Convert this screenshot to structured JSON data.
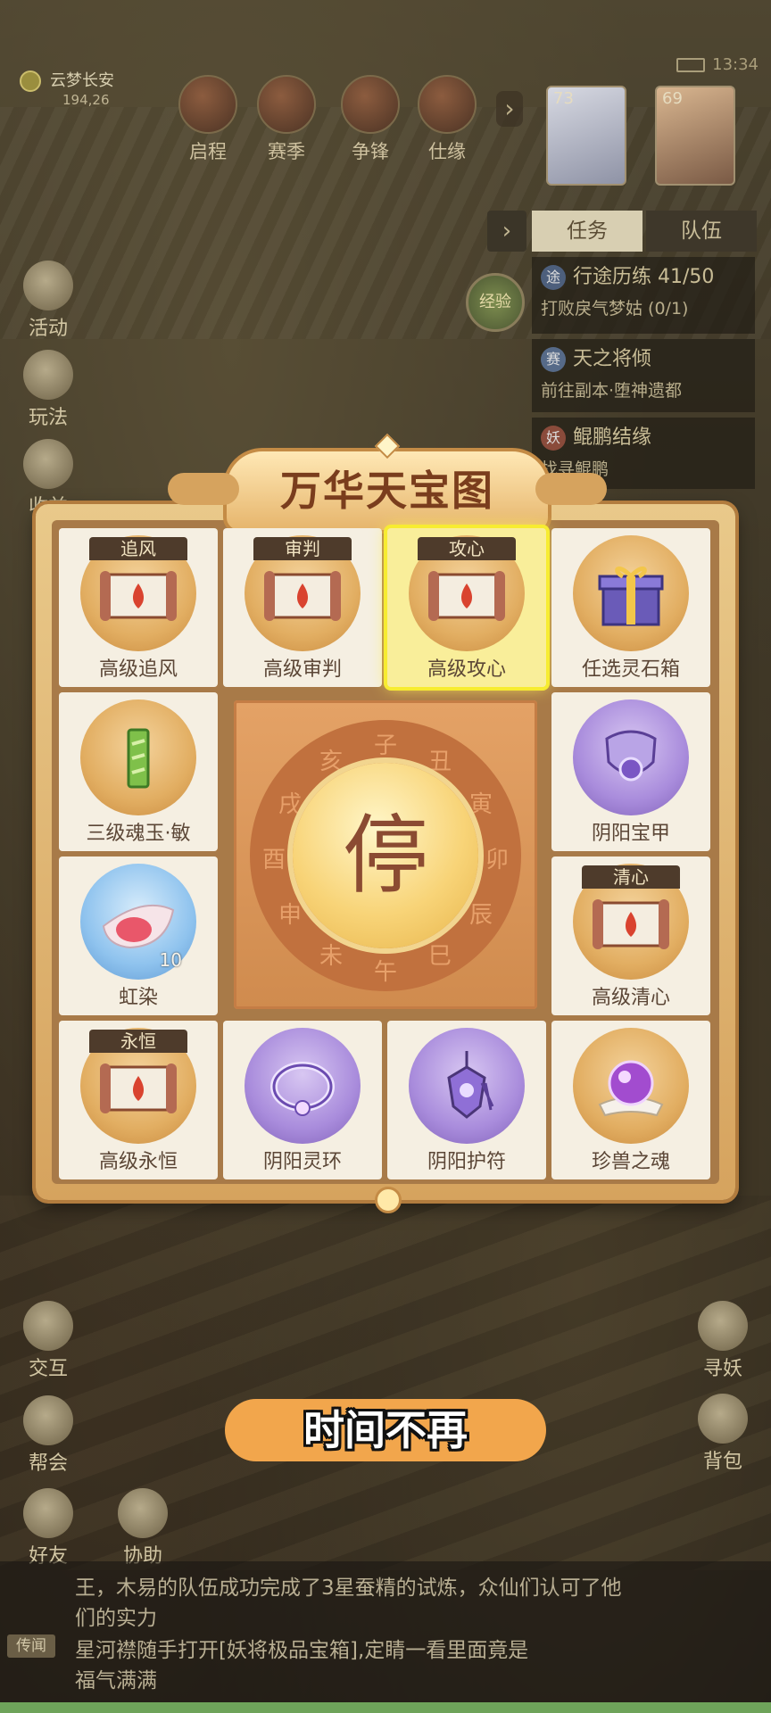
{
  "hud": {
    "location": "云梦长安",
    "coords": "194,26",
    "time": "13:34",
    "top_buttons": [
      "启程",
      "赛季",
      "争锋",
      "仕缘"
    ],
    "portraits": [
      {
        "level": "73"
      },
      {
        "level": "69"
      }
    ]
  },
  "side_left": [
    "活动",
    "玩法",
    "收益"
  ],
  "quest": {
    "tabs": [
      "任务",
      "队伍"
    ],
    "exp_label": "经验",
    "items": [
      {
        "badge": "途",
        "title": "行途历练 41/50",
        "desc": "打败戾气梦姑 (0/1)"
      },
      {
        "badge": "赛",
        "title": "天之将倾",
        "desc": "前往副本·堕神遗都"
      },
      {
        "badge": "妖",
        "title": "鲲鹏结缘",
        "desc": "找寻鲲鹏"
      }
    ]
  },
  "modal": {
    "title": "万华天宝图",
    "center_button": "停",
    "zodiac": [
      "子",
      "丑",
      "寅",
      "卯",
      "辰",
      "巳",
      "午",
      "未",
      "申",
      "酉",
      "戌",
      "亥"
    ],
    "items": [
      {
        "tag": "追风",
        "label": "高级追风"
      },
      {
        "tag": "审判",
        "label": "高级审判"
      },
      {
        "tag": "攻心",
        "label": "高级攻心",
        "highlighted": true
      },
      {
        "tag": "",
        "label": "任选灵石箱"
      },
      {
        "tag": "",
        "label": "三级魂玉·敏"
      },
      {
        "tag": "",
        "label": "阴阳宝甲"
      },
      {
        "tag": "",
        "label": "虹染",
        "qty": "10"
      },
      {
        "tag": "清心",
        "label": "高级清心"
      },
      {
        "tag": "永恒",
        "label": "高级永恒"
      },
      {
        "tag": "",
        "label": "阴阳灵环"
      },
      {
        "tag": "",
        "label": "阴阳护符"
      },
      {
        "tag": "",
        "label": "珍兽之魂"
      }
    ]
  },
  "bottom": {
    "left_buttons": [
      "交互",
      "帮会",
      "好友",
      "协助"
    ],
    "right_buttons": [
      "寻妖",
      "背包"
    ],
    "banner": "时间不再"
  },
  "chat": {
    "line1": "王，木易的队伍成功完成了3星蚕精的试炼，众仙们认可了他",
    "line2": "们的实力",
    "tag": "传闻",
    "line3": "星河襟随手打开[妖将极品宝箱],定睛一看里面竟是",
    "line4": "福气满满"
  },
  "colors": {
    "highlight": "#f7ec31",
    "panel": "#d6a35e",
    "banner": "#f2a64c"
  }
}
